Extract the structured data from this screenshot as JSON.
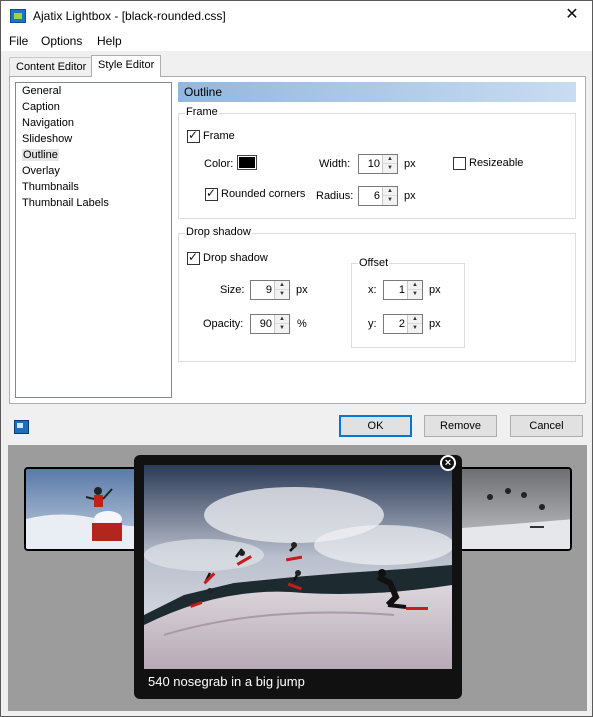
{
  "window": {
    "title": "Ajatix Lightbox - [black-rounded.css]",
    "close_glyph": "✕"
  },
  "menu": [
    "File",
    "Options",
    "Help"
  ],
  "tabs": [
    {
      "label": "Content Editor",
      "active": false
    },
    {
      "label": "Style Editor",
      "active": true
    }
  ],
  "sidebar": {
    "items": [
      "General",
      "Caption",
      "Navigation",
      "Slideshow",
      "Outline",
      "Overlay",
      "Thumbnails",
      "Thumbnail Labels"
    ],
    "selected": "Outline"
  },
  "section": {
    "title": "Outline"
  },
  "frame": {
    "group_label": "Frame",
    "frame_checkbox": {
      "label": "Frame",
      "checked": true
    },
    "color_label": "Color:",
    "color_value": "#000000",
    "width": {
      "label": "Width:",
      "value": "10",
      "unit": "px"
    },
    "resizeable": {
      "label": "Resizeable",
      "checked": false
    },
    "rounded_corners": {
      "label": "Rounded corners",
      "checked": true
    },
    "radius": {
      "label": "Radius:",
      "value": "6",
      "unit": "px"
    }
  },
  "drop_shadow": {
    "group_label": "Drop shadow",
    "checkbox": {
      "label": "Drop shadow",
      "checked": true
    },
    "size": {
      "label": "Size:",
      "value": "9",
      "unit": "px"
    },
    "opacity": {
      "label": "Opacity:",
      "value": "90",
      "unit": "%"
    },
    "offset": {
      "group_label": "Offset",
      "x": {
        "label": "x:",
        "value": "1",
        "unit": "px"
      },
      "y": {
        "label": "y:",
        "value": "2",
        "unit": "px"
      }
    }
  },
  "buttons": {
    "ok": "OK",
    "remove": "Remove",
    "cancel": "Cancel"
  },
  "preview": {
    "caption": "540 nosegrab in a big jump",
    "close_glyph": "×",
    "colors": {
      "background": "#9c9c9c",
      "frame": "#111111"
    }
  },
  "colors": {
    "accent": "#0078d7",
    "header_gradient_start": "#93b7de",
    "header_gradient_end": "#c9dcf1"
  }
}
